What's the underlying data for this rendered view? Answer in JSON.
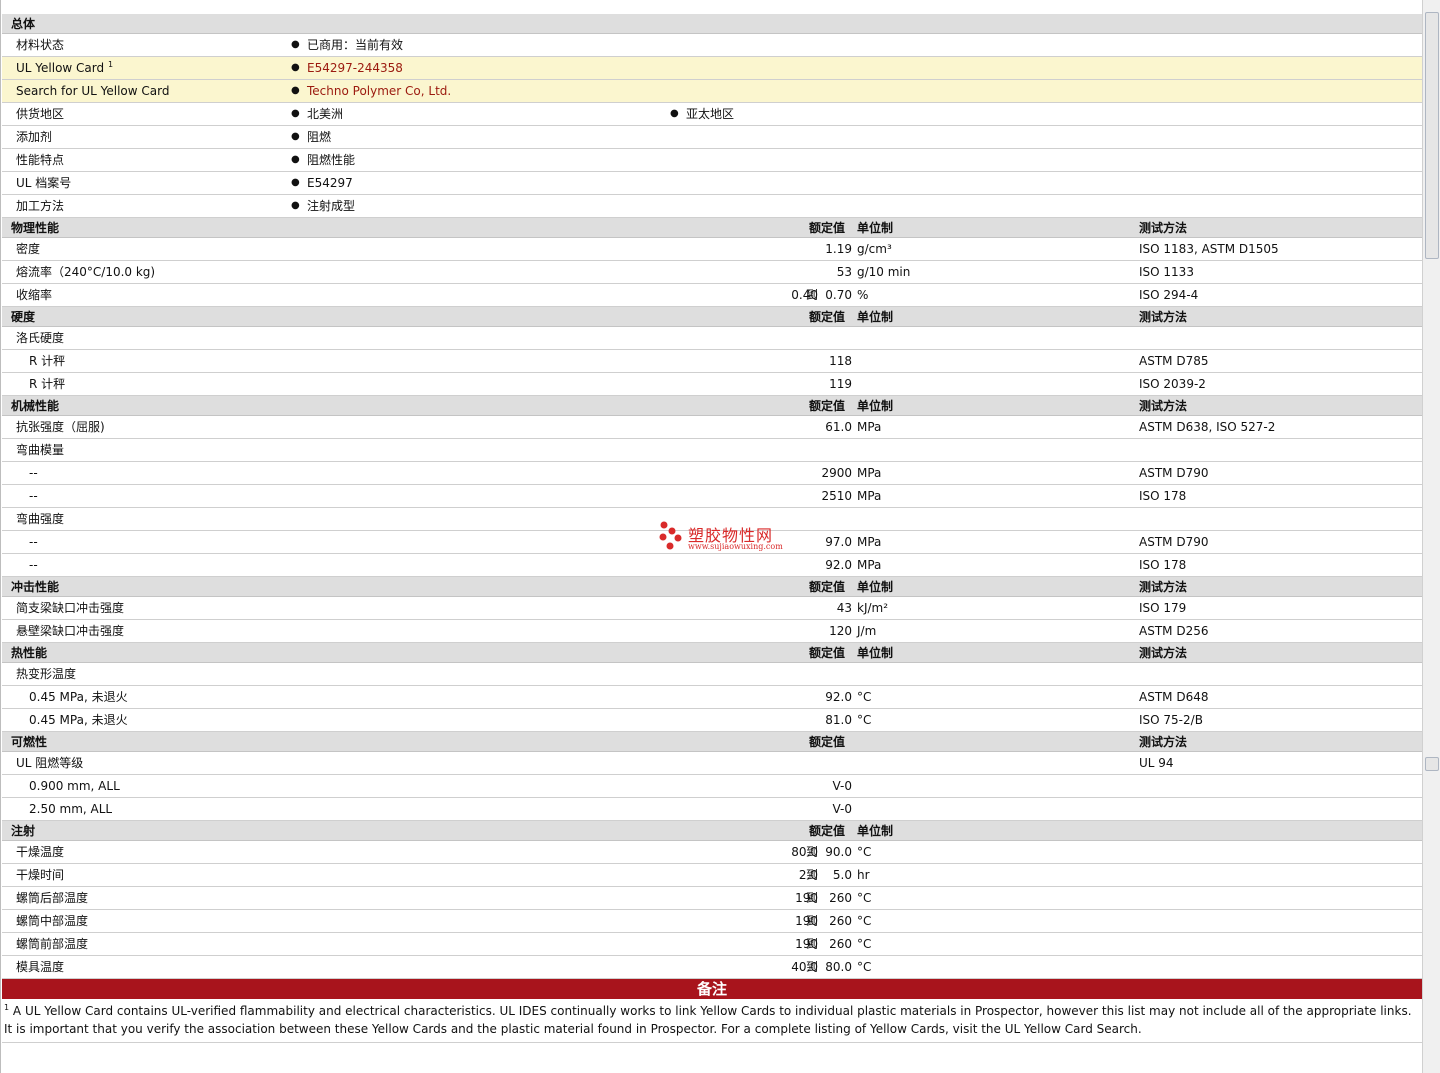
{
  "general": {
    "title": "总体",
    "rows": [
      {
        "name": "材料状态",
        "values": [
          "已商用：当前有效"
        ]
      },
      {
        "name": "UL Yellow Card",
        "sup": "1",
        "values": [
          "E54297-244358"
        ]
      },
      {
        "name": "Search for UL Yellow Card",
        "values": [
          "Techno Polymer Co, Ltd."
        ]
      },
      {
        "name": "供货地区",
        "values": [
          "北美洲",
          "亚太地区"
        ]
      },
      {
        "name": "添加剂",
        "values": [
          "阻燃"
        ]
      },
      {
        "name": "性能特点",
        "values": [
          "阻燃性能"
        ]
      },
      {
        "name": "UL 档案号",
        "values": [
          "E54297"
        ]
      },
      {
        "name": "加工方法",
        "values": [
          "注射成型"
        ]
      }
    ]
  },
  "headers": {
    "rated": "额定值",
    "unit": "单位制",
    "method": "测试方法"
  },
  "sections": {
    "physical": {
      "title": "物理性能",
      "rows": [
        {
          "name": "密度",
          "value": "1.19",
          "unit": "g/cm³",
          "method": "ISO 1183, ASTM D1505"
        },
        {
          "name": "熔流率（240°C/10.0 kg)",
          "value": "53",
          "unit": "g/10 min",
          "method": "ISO 1133"
        },
        {
          "name": "收缩率",
          "value_lo": "0.40",
          "to": "到",
          "value": "0.70",
          "unit": "%",
          "method": "ISO 294-4"
        }
      ]
    },
    "hardness": {
      "title": "硬度",
      "rows": [
        {
          "name": "洛氏硬度"
        },
        {
          "name": "R 计秤",
          "value": "118",
          "method": "ASTM D785"
        },
        {
          "name": "R 计秤",
          "value": "119",
          "method": "ISO 2039-2"
        }
      ]
    },
    "mechanical": {
      "title": "机械性能",
      "rows": [
        {
          "name": "抗张强度（屈服)",
          "value": "61.0",
          "unit": "MPa",
          "method": "ASTM D638, ISO 527-2"
        },
        {
          "name": "弯曲模量"
        },
        {
          "name": "--",
          "value": "2900",
          "unit": "MPa",
          "method": "ASTM D790"
        },
        {
          "name": "--",
          "value": "2510",
          "unit": "MPa",
          "method": "ISO 178"
        },
        {
          "name": "弯曲强度"
        },
        {
          "name": "--",
          "value": "97.0",
          "unit": "MPa",
          "method": "ASTM D790"
        },
        {
          "name": "--",
          "value": "92.0",
          "unit": "MPa",
          "method": "ISO 178"
        }
      ]
    },
    "impact": {
      "title": "冲击性能",
      "rows": [
        {
          "name": "简支梁缺口冲击强度",
          "value": "43",
          "unit": "kJ/m²",
          "method": "ISO 179"
        },
        {
          "name": "悬壁梁缺口冲击强度",
          "value": "120",
          "unit": "J/m",
          "method": "ASTM D256"
        }
      ]
    },
    "thermal": {
      "title": "热性能",
      "rows": [
        {
          "name": "热变形温度"
        },
        {
          "name": "0.45 MPa, 未退火",
          "value": "92.0",
          "unit": "°C",
          "method": "ASTM D648"
        },
        {
          "name": "0.45 MPa, 未退火",
          "value": "81.0",
          "unit": "°C",
          "method": "ISO 75-2/B"
        }
      ]
    },
    "flammability": {
      "title": "可燃性",
      "rows": [
        {
          "name": "UL 阻燃等级",
          "method": "UL 94"
        },
        {
          "name": "0.900 mm, ALL",
          "value": "V-0"
        },
        {
          "name": "2.50 mm, ALL",
          "value": "V-0"
        }
      ]
    },
    "injection": {
      "title": "注射",
      "rows": [
        {
          "name": "干燥温度",
          "value_lo": "80.0",
          "to": "到",
          "value": "90.0",
          "unit": "°C"
        },
        {
          "name": "干燥时间",
          "value_lo": "2.0",
          "to": "到",
          "value": "5.0",
          "unit": "hr"
        },
        {
          "name": "螺筒后部温度",
          "value_lo": "190",
          "to": "到",
          "value": "260",
          "unit": "°C"
        },
        {
          "name": "螺筒中部温度",
          "value_lo": "190",
          "to": "到",
          "value": "260",
          "unit": "°C"
        },
        {
          "name": "螺筒前部温度",
          "value_lo": "190",
          "to": "到",
          "value": "260",
          "unit": "°C"
        },
        {
          "name": "模具温度",
          "value_lo": "40.0",
          "to": "到",
          "value": "80.0",
          "unit": "°C"
        }
      ]
    }
  },
  "notes": {
    "title": "备注",
    "sup": "1",
    "text": "A UL Yellow Card contains UL-verified flammability and electrical characteristics. UL IDES continually works to link Yellow Cards to individual plastic materials in Prospector, however this list may not include all of the appropriate links. It is important that you verify the association between these Yellow Cards and the plastic material found in Prospector. For a complete listing of Yellow Cards, visit the UL Yellow Card Search."
  },
  "watermark": {
    "title": "塑胶物性网",
    "url": "www.sujiaowuxing.com",
    "color": "#d92a2a"
  },
  "colors": {
    "header_bg": "#dedede",
    "yellow_row": "#fbf6cf",
    "link": "#9b1a0f",
    "notes_bar": "#a8141c"
  }
}
